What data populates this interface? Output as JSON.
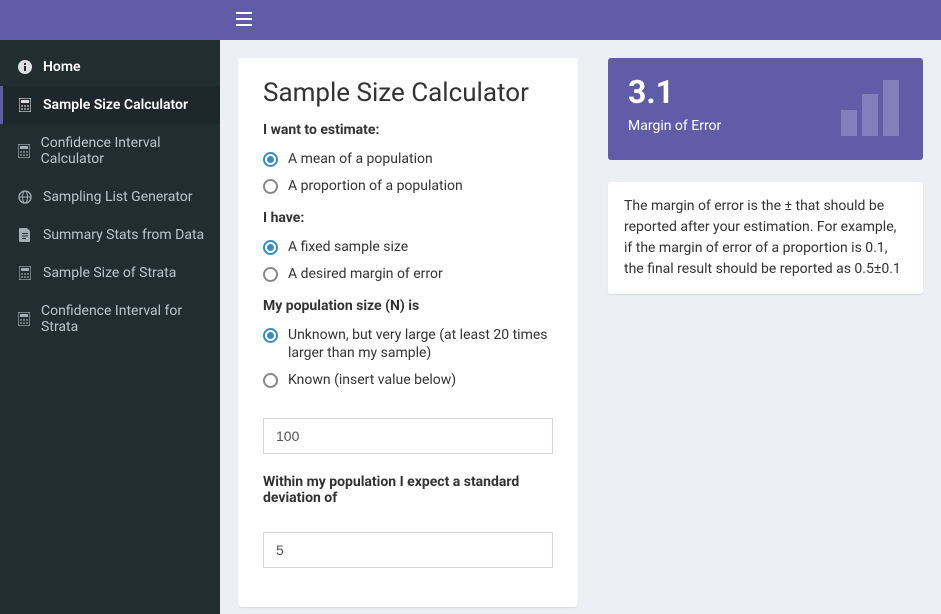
{
  "sidebar": {
    "items": [
      {
        "label": "Home",
        "icon": "info"
      },
      {
        "label": "Sample Size Calculator",
        "icon": "calc"
      },
      {
        "label": "Confidence Interval Calculator",
        "icon": "calc"
      },
      {
        "label": "Sampling List Generator",
        "icon": "globe"
      },
      {
        "label": "Summary Stats from Data",
        "icon": "file"
      },
      {
        "label": "Sample Size of Strata",
        "icon": "calc"
      },
      {
        "label": "Confidence Interval for Strata",
        "icon": "calc"
      }
    ]
  },
  "form": {
    "title": "Sample Size Calculator",
    "estimate_label": "I want to estimate:",
    "estimate_options": {
      "mean": "A mean of a population",
      "prop": "A proportion of a population"
    },
    "have_label": "I have:",
    "have_options": {
      "fixed": "A fixed sample size",
      "moe": "A desired margin of error"
    },
    "pop_label": "My population size (N) is",
    "pop_options": {
      "unknown": "Unknown, but very large (at least 20 times larger than my sample)",
      "known": "Known (insert value below)"
    },
    "pop_input_value": "100",
    "sd_label": "Within my population I expect a standard deviation of",
    "sd_input_value": "5"
  },
  "result": {
    "value": "3.1",
    "label": "Margin of Error",
    "explain": "The margin of error is the ± that should be reported after your estimation. For example, if the margin of error of a proportion is 0.1, the final result should be reported as 0.5±0.1"
  }
}
